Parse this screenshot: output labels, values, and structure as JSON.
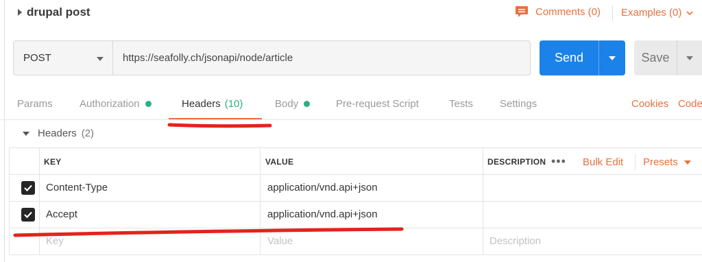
{
  "title": "drupal post",
  "header_links": {
    "comments": "Comments (0)",
    "examples": "Examples (0)"
  },
  "request": {
    "method": "POST",
    "url": "https://seafolly.ch/jsonapi/node/article",
    "send_label": "Send",
    "save_label": "Save"
  },
  "tabs": [
    {
      "label": "Params",
      "dot": false
    },
    {
      "label": "Authorization",
      "dot": true
    },
    {
      "label": "Headers",
      "count": "(10)",
      "active": true
    },
    {
      "label": "Body",
      "dot": true
    },
    {
      "label": "Pre-request Script",
      "dot": false
    },
    {
      "label": "Tests",
      "dot": false
    },
    {
      "label": "Settings",
      "dot": false
    }
  ],
  "right_links": {
    "cookies": "Cookies",
    "code": "Code"
  },
  "headers_section": {
    "title": "Headers",
    "count": "(2)"
  },
  "table": {
    "columns": {
      "key": "KEY",
      "value": "VALUE",
      "description": "DESCRIPTION"
    },
    "more_icon": "•••",
    "bulk_edit": "Bulk Edit",
    "presets": "Presets",
    "rows": [
      {
        "checked": true,
        "key": "Content-Type",
        "value": "application/vnd.api+json",
        "description": ""
      },
      {
        "checked": true,
        "key": "Accept",
        "value": "application/vnd.api+json",
        "description": ""
      }
    ],
    "placeholders": {
      "key": "Key",
      "value": "Value",
      "description": "Description"
    }
  },
  "colors": {
    "accent": "#e8703f",
    "send_blue": "#1a82e8",
    "status_green": "#2bb07f",
    "annotation_red": "#e3241b"
  },
  "icons": [
    "caret-right-icon",
    "comment-icon",
    "chevron-down-icon",
    "checkbox-checked-icon",
    "more-icon"
  ]
}
